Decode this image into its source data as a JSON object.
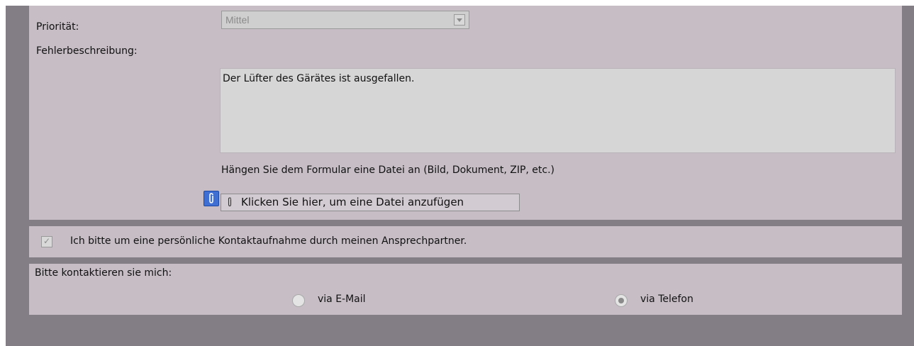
{
  "form": {
    "priority_label": "Priorität:",
    "priority_value": "Mittel",
    "description_label": "Fehlerbeschreibung:",
    "description_value": "Der Lüfter des Gärätes ist ausgefallen.",
    "attach_hint": "Hängen Sie dem Formular eine Datei an (Bild, Dokument, ZIP, etc.)",
    "attach_button_label": "Klicken Sie hier, um eine Datei anzufügen"
  },
  "contact_request": {
    "checkbox_label": "Ich bitte um eine persönliche Kontaktaufnahme durch meinen Ansprechpartner.",
    "checked": true
  },
  "contact_method": {
    "label": "Bitte kontaktieren sie mich:",
    "options": [
      {
        "label": "via E-Mail",
        "selected": false
      },
      {
        "label": "via Telefon",
        "selected": true
      }
    ]
  },
  "icons": {
    "attach": "paperclip-icon",
    "dropdown": "chevron-down-icon",
    "check": "checkmark-icon"
  },
  "colors": {
    "background": "#837e85",
    "panel": "#c6bdc5",
    "input": "#d6d6d6",
    "accent": "#3f6fd3"
  }
}
